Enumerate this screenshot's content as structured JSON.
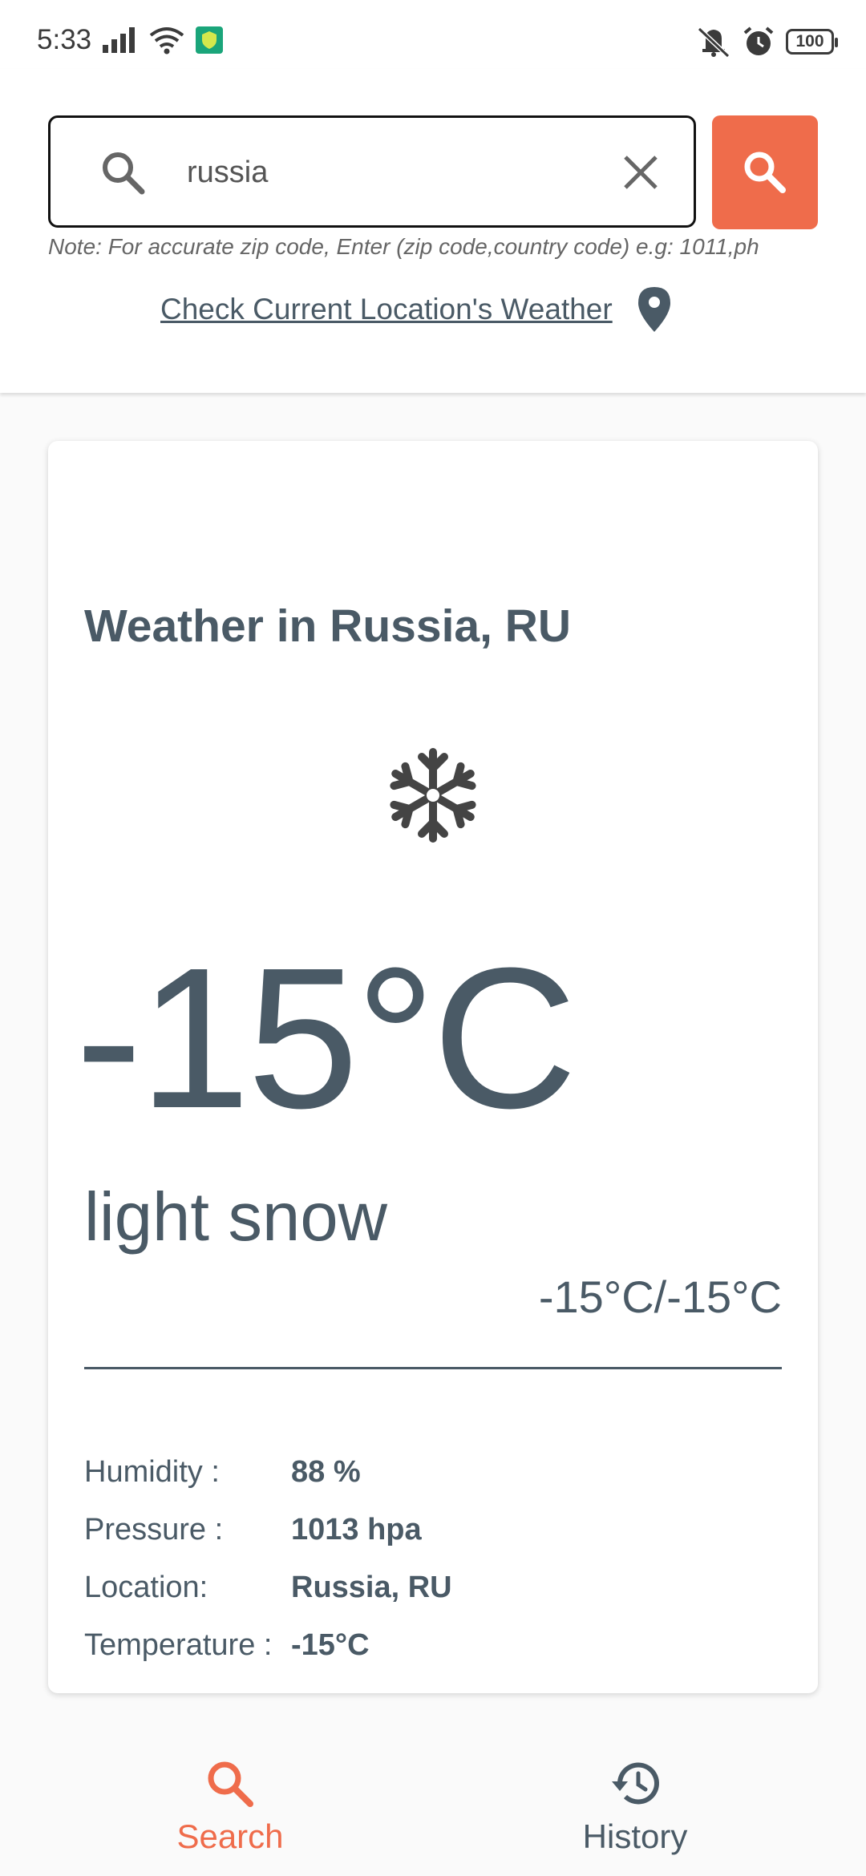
{
  "status_bar": {
    "time": "5:33",
    "battery": "100",
    "icons": [
      "signal-icon",
      "wifi-icon",
      "shield-app-icon",
      "mute-icon",
      "alarm-icon",
      "battery-icon"
    ]
  },
  "search": {
    "value": "russia",
    "note": "Note: For accurate zip code, Enter (zip code,country code) e.g: 1011,ph",
    "current_location_link": "Check Current Location's Weather"
  },
  "weather": {
    "title": "Weather in Russia, RU",
    "icon": "snowflake-icon",
    "temperature": "-15°C",
    "description": "light snow",
    "range": "-15°C/-15°C",
    "details": [
      {
        "label": "Humidity :",
        "value": "88 %"
      },
      {
        "label": "Pressure :",
        "value": "1013 hpa"
      },
      {
        "label": "Location:",
        "value": "Russia, RU"
      },
      {
        "label": "Temperature :",
        "value": "-15°C"
      }
    ]
  },
  "nav": {
    "search_label": "Search",
    "history_label": "History"
  },
  "colors": {
    "accent": "#ef6c4b",
    "text": "#4a5a66"
  }
}
